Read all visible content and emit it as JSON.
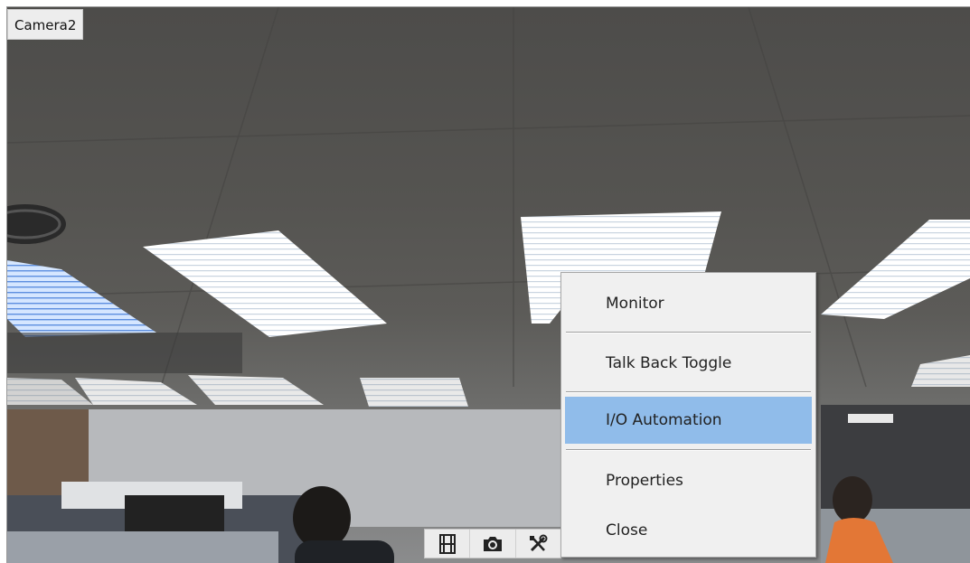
{
  "camera": {
    "title": "Camera2"
  },
  "toolbar": {
    "buttons": [
      {
        "icon": "film-icon"
      },
      {
        "icon": "camera-icon"
      },
      {
        "icon": "tools-icon"
      }
    ]
  },
  "context_menu": {
    "items": [
      {
        "label": "Monitor",
        "highlighted": false
      },
      {
        "label": "Talk Back Toggle",
        "highlighted": false
      },
      {
        "label": "I/O Automation",
        "highlighted": true
      },
      {
        "label": "Properties",
        "highlighted": false
      },
      {
        "label": "Close",
        "highlighted": false
      }
    ],
    "highlight_color": "#90bcea"
  }
}
